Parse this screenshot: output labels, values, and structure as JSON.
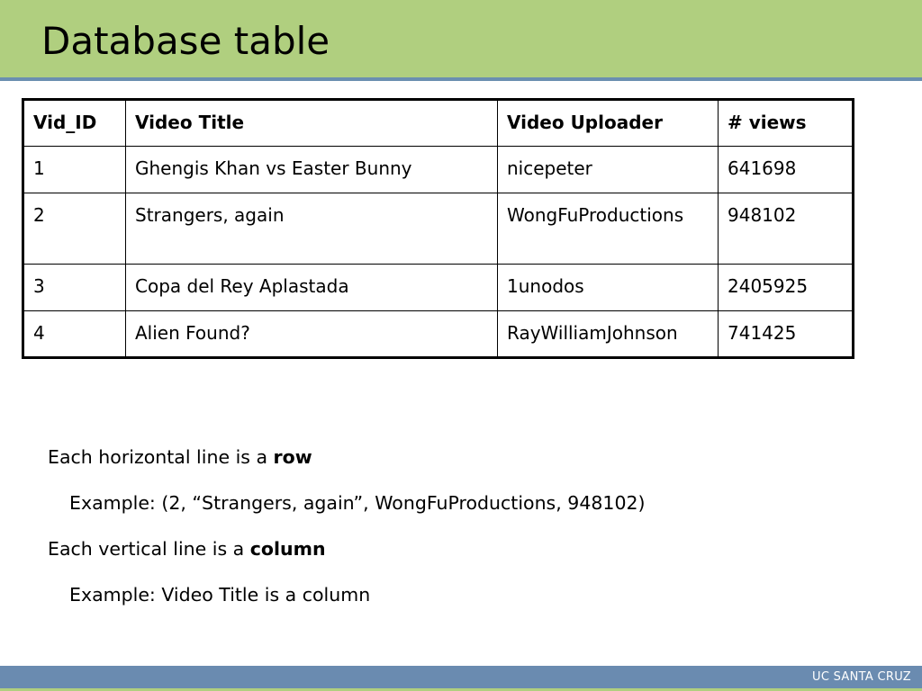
{
  "slide": {
    "title": "Database table",
    "footer": "UC SANTA CRUZ"
  },
  "table": {
    "headers": [
      "Vid_ID",
      "Video Title",
      "Video Uploader",
      "# views"
    ],
    "rows": [
      [
        "1",
        "Ghengis Khan vs Easter Bunny",
        "nicepeter",
        "641698"
      ],
      [
        "2",
        "Strangers, again",
        "WongFuProductions",
        "948102"
      ],
      [
        "3",
        "Copa del Rey Aplastada",
        "1unodos",
        "2405925"
      ],
      [
        "4",
        "Alien Found?",
        "RayWilliamJohnson",
        "741425"
      ]
    ]
  },
  "notes": {
    "row_prefix": "Each horizontal line is a ",
    "row_term": "row",
    "row_example": "Example: (2, “Strangers, again”, WongFuProductions, 948102)",
    "column_prefix": "Each vertical line is a ",
    "column_term": "column",
    "column_example": "Example: Video Title is a column"
  },
  "colors": {
    "title_bar": "#b0cf7f",
    "rule_and_footer": "#6a8bb0"
  }
}
